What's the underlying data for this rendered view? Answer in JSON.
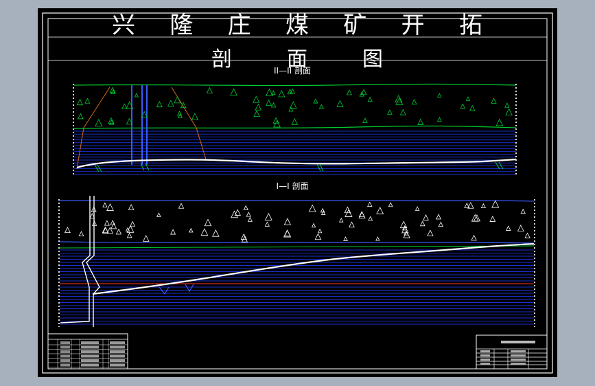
{
  "window": {
    "background_color": "#a7b1bd",
    "sheet_color": "#000000"
  },
  "drawing": {
    "title_line1": "兴  隆  庄  煤  矿  开  拓",
    "title_line2": "剖   面   图",
    "section_upper_label": "II—II 剖面",
    "section_lower_label": "I—I 剖面"
  },
  "colors": {
    "border": "#ffffff",
    "ground": "#00cc33",
    "strata": "#1a2fd0",
    "seam": "#ffffff",
    "shaft": "#3a5bff",
    "marker": "#c0c0c0",
    "red_line": "#cc2200",
    "slope": "#d06a1a"
  }
}
